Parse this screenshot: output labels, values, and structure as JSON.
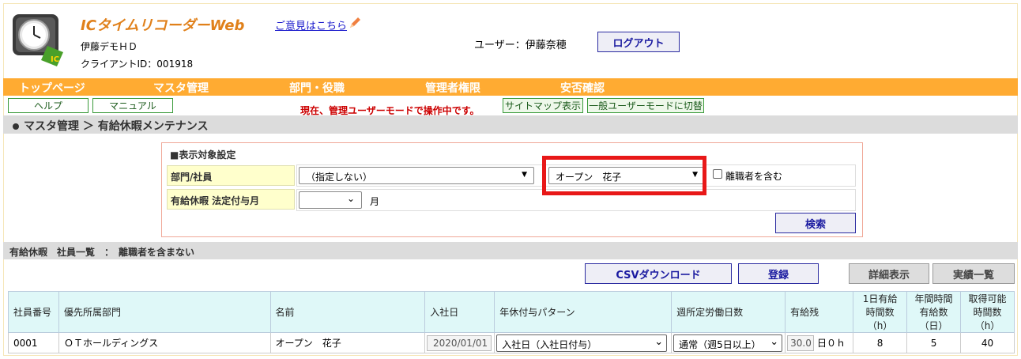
{
  "header": {
    "app_title": "ICタイムリコーダーWeb",
    "feedback_link": "ご意見はこちら",
    "company": "伊藤デモＨＤ",
    "client_id": "クライアントID：001918",
    "user_label": "ユーザー：伊藤奈穂",
    "logout_label": "ログアウト"
  },
  "nav": {
    "items": [
      "トップページ",
      "マスタ管理",
      "部門・役職",
      "管理者権限",
      "安否確認"
    ]
  },
  "subbar": {
    "help": "ヘルプ",
    "manual": "マニュアル",
    "mode_warning": "現在、管理ユーザーモードで操作中です。",
    "sitemap": "サイトマップ表示",
    "general_mode": "一般ユーザーモードに切替"
  },
  "breadcrumb": "マスタ管理 ＞ 有給休暇メンテナンス",
  "filter": {
    "title": "■表示対象設定",
    "dept_label": "部門/社員",
    "dept_value": "（指定しない）",
    "employee_value": "オープン　花子",
    "include_retired": "離職者を含む",
    "month_label": "有給休暇 法定付与月",
    "month_value": "",
    "month_unit": "月",
    "search_label": "検索"
  },
  "list": {
    "heading": "有給休暇　社員一覧　：　離職者を含まない",
    "csv_label": "CSVダウンロード",
    "register_label": "登録",
    "detail_label": "詳細表示",
    "results_label": "実績一覧",
    "columns": [
      "社員番号",
      "優先所属部門",
      "名前",
      "入社日",
      "年休付与パターン",
      "週所定労働日数",
      "有給残",
      "1日有給時間数（h）",
      "年間時間有給数（日）",
      "取得可能時間数（h）"
    ],
    "rows": [
      {
        "emp_no": "0001",
        "dept": "ＯＴホールディングス",
        "name": "オープン　花子",
        "hire_date": "2020/01/01",
        "pattern": "入社日（入社日付与）",
        "weekly_days": "通常（週5日以上）",
        "balance": "30.0",
        "balance_unit": "日０ｈ",
        "daily_hours": "8",
        "annual_days": "5",
        "available_hours": "40"
      }
    ]
  },
  "colors": {
    "nav_bg": "#ffab32",
    "title_orange": "#e0801a",
    "highlight_red": "#e81818",
    "header_cell_cyan": "#dff8f8",
    "label_yellow": "#ffffcc"
  }
}
